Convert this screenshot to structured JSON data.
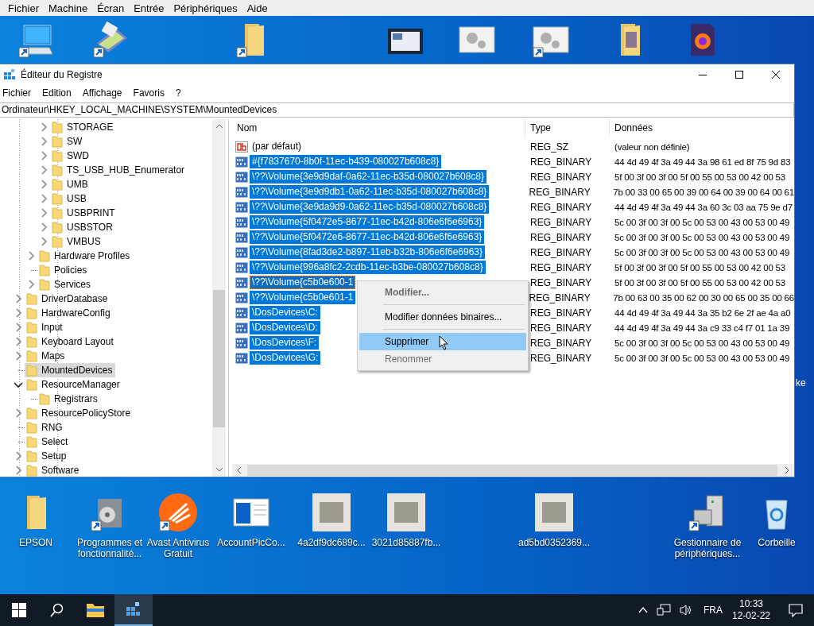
{
  "host_menu": [
    "Fichier",
    "Machine",
    "Écran",
    "Entrée",
    "Périphériques",
    "Aide"
  ],
  "desktop_top_icons": [
    {
      "kind": "computer",
      "shortcut": true
    },
    {
      "kind": "scanner",
      "shortcut": true
    },
    {
      "kind": "folder",
      "shortcut": true
    },
    {
      "kind": "window-thumbnail",
      "shortcut": false
    },
    {
      "kind": "gear-window",
      "shortcut": false
    },
    {
      "kind": "gear-window",
      "shortcut": true
    },
    {
      "kind": "folder-image",
      "shortcut": false
    },
    {
      "kind": "firefox-file",
      "shortcut": false
    }
  ],
  "partial_icon_label": "ke",
  "window": {
    "title": "Éditeur du Registre",
    "menu": [
      "Fichier",
      "Edition",
      "Affichage",
      "Favoris",
      "?"
    ],
    "address": "Ordinateur\\HKEY_LOCAL_MACHINE\\SYSTEM\\MountedDevices",
    "tree": {
      "items": [
        {
          "children": [
            {
              "children": [
                {
                  "label": "STORAGE",
                  "expandable": true,
                  "expanded": false,
                  "selected": false
                },
                {
                  "label": "SW",
                  "expandable": true,
                  "expanded": false,
                  "selected": false
                },
                {
                  "label": "SWD",
                  "expandable": true,
                  "expanded": false,
                  "selected": false
                },
                {
                  "label": "TS_USB_HUB_Enumerator",
                  "expandable": true,
                  "expanded": false,
                  "selected": false
                },
                {
                  "label": "UMB",
                  "expandable": true,
                  "expanded": false,
                  "selected": false
                },
                {
                  "label": "USB",
                  "expandable": true,
                  "expanded": false,
                  "selected": false
                },
                {
                  "label": "USBPRINT",
                  "expandable": true,
                  "expanded": false,
                  "selected": false
                },
                {
                  "label": "USBSTOR",
                  "expandable": true,
                  "expanded": false,
                  "selected": false
                },
                {
                  "label": "VMBUS",
                  "expandable": true,
                  "expanded": false,
                  "selected": false
                }
              ]
            },
            {
              "label": "Hardware Profiles",
              "expandable": true,
              "expanded": false,
              "selected": false
            },
            {
              "label": "Policies",
              "expandable": false,
              "selected": false
            },
            {
              "label": "Services",
              "expandable": true,
              "expanded": false,
              "selected": false
            }
          ]
        },
        {
          "label": "DriverDatabase",
          "expandable": true,
          "expanded": false,
          "selected": false
        },
        {
          "label": "HardwareConfig",
          "expandable": true,
          "expanded": false,
          "selected": false
        },
        {
          "label": "Input",
          "expandable": true,
          "expanded": false,
          "selected": false
        },
        {
          "label": "Keyboard Layout",
          "expandable": true,
          "expanded": false,
          "selected": false
        },
        {
          "label": "Maps",
          "expandable": true,
          "expanded": false,
          "selected": false
        },
        {
          "label": "MountedDevices",
          "expandable": false,
          "selected": true
        },
        {
          "label": "ResourceManager",
          "expandable": true,
          "expanded": true,
          "selected": false,
          "children": [
            {
              "label": "Registrars",
              "expandable": false,
              "selected": false
            }
          ]
        },
        {
          "label": "ResourcePolicyStore",
          "expandable": true,
          "expanded": false,
          "selected": false
        },
        {
          "label": "RNG",
          "expandable": false,
          "selected": false
        },
        {
          "label": "Select",
          "expandable": false,
          "selected": false
        },
        {
          "label": "Setup",
          "expandable": true,
          "expanded": false,
          "selected": false
        },
        {
          "label": "Software",
          "expandable": true,
          "expanded": false,
          "selected": false
        }
      ]
    },
    "columns": [
      "Nom",
      "Type",
      "Données"
    ],
    "rows": [
      {
        "kind": "string",
        "name": "(par défaut)",
        "type": "REG_SZ",
        "data": "(valeur non définie)",
        "selected": false,
        "focused": false
      },
      {
        "kind": "binary",
        "name": "#{f7837670-8b0f-11ec-b439-080027b608c8}",
        "type": "REG_BINARY",
        "data": "44 4d 49 4f 3a 49 44 3a 98 61 ed 8f 75 9d 83",
        "selected": true,
        "focused": false
      },
      {
        "kind": "binary",
        "name": "\\??\\Volume{3e9d9daf-0a62-11ec-b35d-080027b608c8}",
        "type": "REG_BINARY",
        "data": "5f 00 3f 00 3f 00 5f 00 55 00 53 00 42 00 53",
        "selected": true,
        "focused": false
      },
      {
        "kind": "binary",
        "name": "\\??\\Volume{3e9d9db1-0a62-11ec-b35d-080027b608c8}",
        "type": "REG_BINARY",
        "data": "7b 00 33 00 65 00 39 00 64 00 39 00 64 00 61",
        "selected": true,
        "focused": false
      },
      {
        "kind": "binary",
        "name": "\\??\\Volume{3e9da9d9-0a62-11ec-b35d-080027b608c8}",
        "type": "REG_BINARY",
        "data": "44 4d 49 4f 3a 49 44 3a 60 3c 03 aa 75 9e d7",
        "selected": true,
        "focused": false
      },
      {
        "kind": "binary",
        "name": "\\??\\Volume{5f0472e5-8677-11ec-b42d-806e6f6e6963}",
        "type": "REG_BINARY",
        "data": "5c 00 3f 00 3f 00 5c 00 53 00 43 00 53 00 49",
        "selected": true,
        "focused": false
      },
      {
        "kind": "binary",
        "name": "\\??\\Volume{5f0472e6-8677-11ec-b42d-806e6f6e6963}",
        "type": "REG_BINARY",
        "data": "5c 00 3f 00 3f 00 5c 00 53 00 43 00 53 00 49",
        "selected": true,
        "focused": false
      },
      {
        "kind": "binary",
        "name": "\\??\\Volume{8fad3de2-b897-11eb-b32b-806e6f6e6963}",
        "type": "REG_BINARY",
        "data": "5c 00 3f 00 3f 00 5c 00 53 00 43 00 53 00 49",
        "selected": true,
        "focused": false
      },
      {
        "kind": "binary",
        "name": "\\??\\Volume{996a8fc2-2cdb-11ec-b3be-080027b608c8}",
        "type": "REG_BINARY",
        "data": "5f 00 3f 00 3f 00 5f 00 55 00 53 00 42 00 53",
        "selected": true,
        "focused": false
      },
      {
        "kind": "binary",
        "name": "\\??\\Volume{c5b0e600-1",
        "type": "REG_BINARY",
        "data": "5f 00 3f 00 3f 00 5f 00 55 00 53 00 42 00 53",
        "selected": true,
        "focused": true
      },
      {
        "kind": "binary",
        "name": "\\??\\Volume{c5b0e601-1",
        "type": "REG_BINARY",
        "data": "7b 00 63 00 35 00 62 00 30 00 65 00 35 00 66",
        "selected": true,
        "focused": false
      },
      {
        "kind": "binary",
        "name": "\\DosDevices\\C:",
        "type": "REG_BINARY",
        "data": "44 4d 49 4f 3a 49 44 3a 35 b2 6e 2f ae 4a a0",
        "selected": true,
        "focused": false
      },
      {
        "kind": "binary",
        "name": "\\DosDevices\\D:",
        "type": "REG_BINARY",
        "data": "44 4d 49 4f 3a 49 44 3a c9 33 c4 f7 01 1a 39",
        "selected": true,
        "focused": false
      },
      {
        "kind": "binary",
        "name": "\\DosDevices\\F:",
        "type": "REG_BINARY",
        "data": "5c 00 3f 00 3f 00 5c 00 53 00 43 00 53 00 49",
        "selected": true,
        "focused": false
      },
      {
        "kind": "binary",
        "name": "\\DosDevices\\G:",
        "type": "REG_BINARY",
        "data": "5c 00 3f 00 3f 00 5c 00 53 00 43 00 53 00 49",
        "selected": true,
        "focused": false
      }
    ]
  },
  "context_menu": [
    {
      "kind": "item",
      "label": "Modifier...",
      "default": true,
      "disabled": true,
      "selected": false
    },
    {
      "kind": "separator"
    },
    {
      "kind": "item",
      "label": "Modifier données binaires...",
      "default": false,
      "disabled": false,
      "selected": false
    },
    {
      "kind": "separator"
    },
    {
      "kind": "item",
      "label": "Supprimer",
      "default": false,
      "disabled": false,
      "selected": true
    },
    {
      "kind": "item",
      "label": "Renommer",
      "default": false,
      "disabled": true,
      "selected": false
    }
  ],
  "desktop_bottom_icons": [
    {
      "kind": "folder",
      "label": "EPSON",
      "shortcut": false
    },
    {
      "kind": "programs",
      "label": "Programmes et fonctionnalité...",
      "shortcut": true
    },
    {
      "kind": "avast",
      "label": "Avast Antivirus Gratuit",
      "shortcut": true
    },
    {
      "kind": "window-thumbnail",
      "label": "AccountPicCo...",
      "shortcut": false
    },
    {
      "kind": "photo",
      "label": "4a2df9dc689c...",
      "shortcut": false
    },
    {
      "kind": "photo",
      "label": "3021d85887fb...",
      "shortcut": false
    },
    {
      "kind": "photo",
      "label": "ad5bd0352369...",
      "shortcut": false
    },
    {
      "kind": "device-manager",
      "label": "Gestionnaire de périphériques...",
      "shortcut": true
    },
    {
      "kind": "recycle-bin",
      "label": "Corbeille",
      "shortcut": false
    }
  ],
  "taskbar": {
    "apps": [
      {
        "kind": "start",
        "selected": false
      },
      {
        "kind": "search",
        "selected": false
      },
      {
        "kind": "explorer",
        "selected": false
      },
      {
        "kind": "regedit",
        "selected": true
      }
    ],
    "language": "FRA",
    "time": "10:33",
    "date": "12-02-22"
  }
}
